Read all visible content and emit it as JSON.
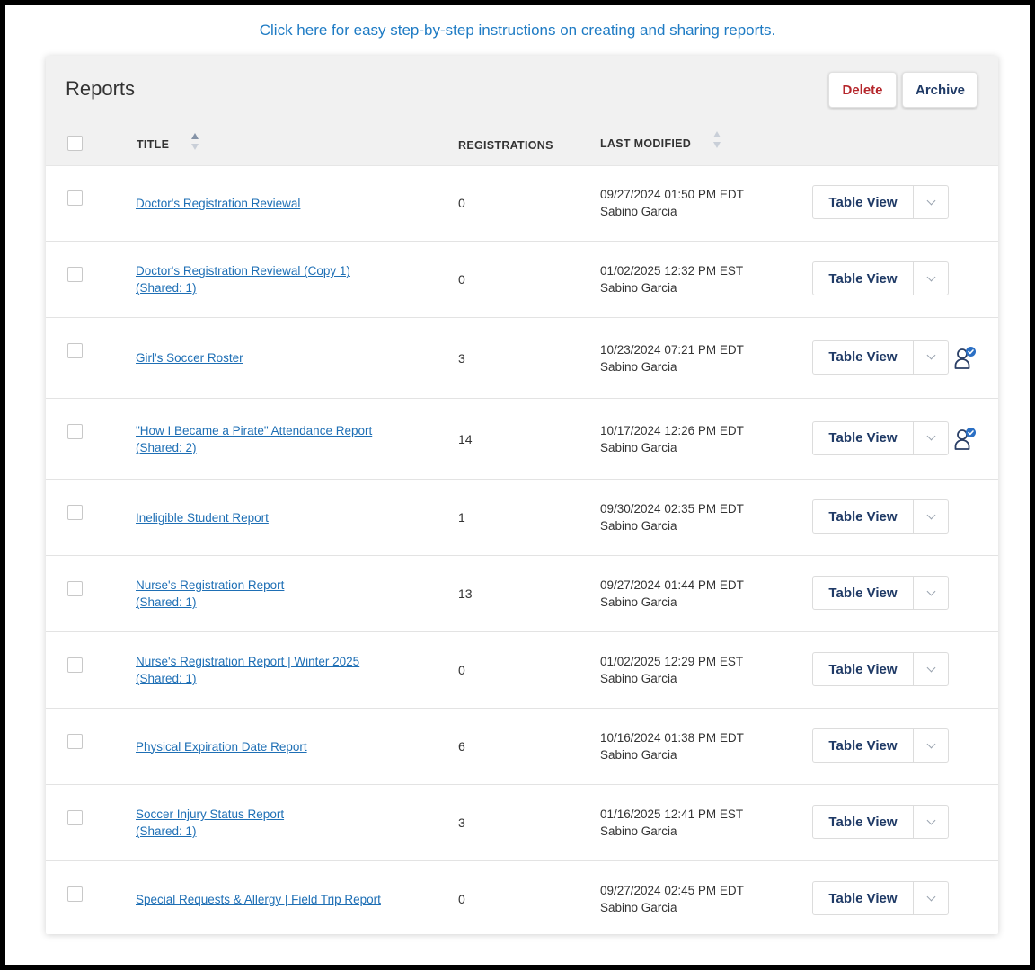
{
  "help_link": "Click here for easy step-by-step instructions on creating and sharing reports.",
  "card": {
    "title": "Reports",
    "delete_label": "Delete",
    "archive_label": "Archive"
  },
  "columns": {
    "title": "TITLE",
    "registrations": "REGISTRATIONS",
    "last_modified": "LAST MODIFIED"
  },
  "row_action_label": "Table View",
  "icons": {
    "sort": "sort-arrows-icon",
    "chevron": "chevron-down-icon",
    "shared": "user-check-icon"
  },
  "colors": {
    "link": "#1e6fb5",
    "delete": "#b5262b",
    "primary_text": "#1f3a66",
    "header_bg": "#f1f1f1"
  },
  "rows": [
    {
      "title": "Doctor's Registration Reviewal",
      "shared": "",
      "registrations": "0",
      "date": "09/27/2024 01:50 PM EDT",
      "user": "Sabino Garcia",
      "shared_icon": false
    },
    {
      "title": "Doctor's Registration Reviewal (Copy 1)",
      "shared": "(Shared: 1)",
      "registrations": "0",
      "date": "01/02/2025 12:32 PM EST",
      "user": "Sabino Garcia",
      "shared_icon": false
    },
    {
      "title": "Girl's Soccer Roster",
      "shared": "",
      "registrations": "3",
      "date": "10/23/2024 07:21 PM EDT",
      "user": "Sabino Garcia",
      "shared_icon": true
    },
    {
      "title": "\"How I Became a Pirate\" Attendance Report",
      "shared": "(Shared: 2)",
      "registrations": "14",
      "date": "10/17/2024 12:26 PM EDT",
      "user": "Sabino Garcia",
      "shared_icon": true
    },
    {
      "title": "Ineligible Student Report",
      "shared": "",
      "registrations": "1",
      "date": "09/30/2024 02:35 PM EDT",
      "user": "Sabino Garcia",
      "shared_icon": false
    },
    {
      "title": "Nurse's Registration Report",
      "shared": "(Shared: 1)",
      "registrations": "13",
      "date": "09/27/2024 01:44 PM EDT",
      "user": "Sabino Garcia",
      "shared_icon": false
    },
    {
      "title": "Nurse's Registration Report | Winter 2025",
      "shared": "(Shared: 1)",
      "registrations": "0",
      "date": "01/02/2025 12:29 PM EST",
      "user": "Sabino Garcia",
      "shared_icon": false
    },
    {
      "title": "Physical Expiration Date Report",
      "shared": "",
      "registrations": "6",
      "date": "10/16/2024 01:38 PM EDT",
      "user": "Sabino Garcia",
      "shared_icon": false
    },
    {
      "title": "Soccer Injury Status Report",
      "shared": "(Shared: 1)",
      "registrations": "3",
      "date": "01/16/2025 12:41 PM EST",
      "user": "Sabino Garcia",
      "shared_icon": false
    },
    {
      "title": "Special Requests & Allergy | Field Trip Report",
      "shared": "",
      "registrations": "0",
      "date": "09/27/2024 02:45 PM EDT",
      "user": "Sabino Garcia",
      "shared_icon": false
    }
  ]
}
